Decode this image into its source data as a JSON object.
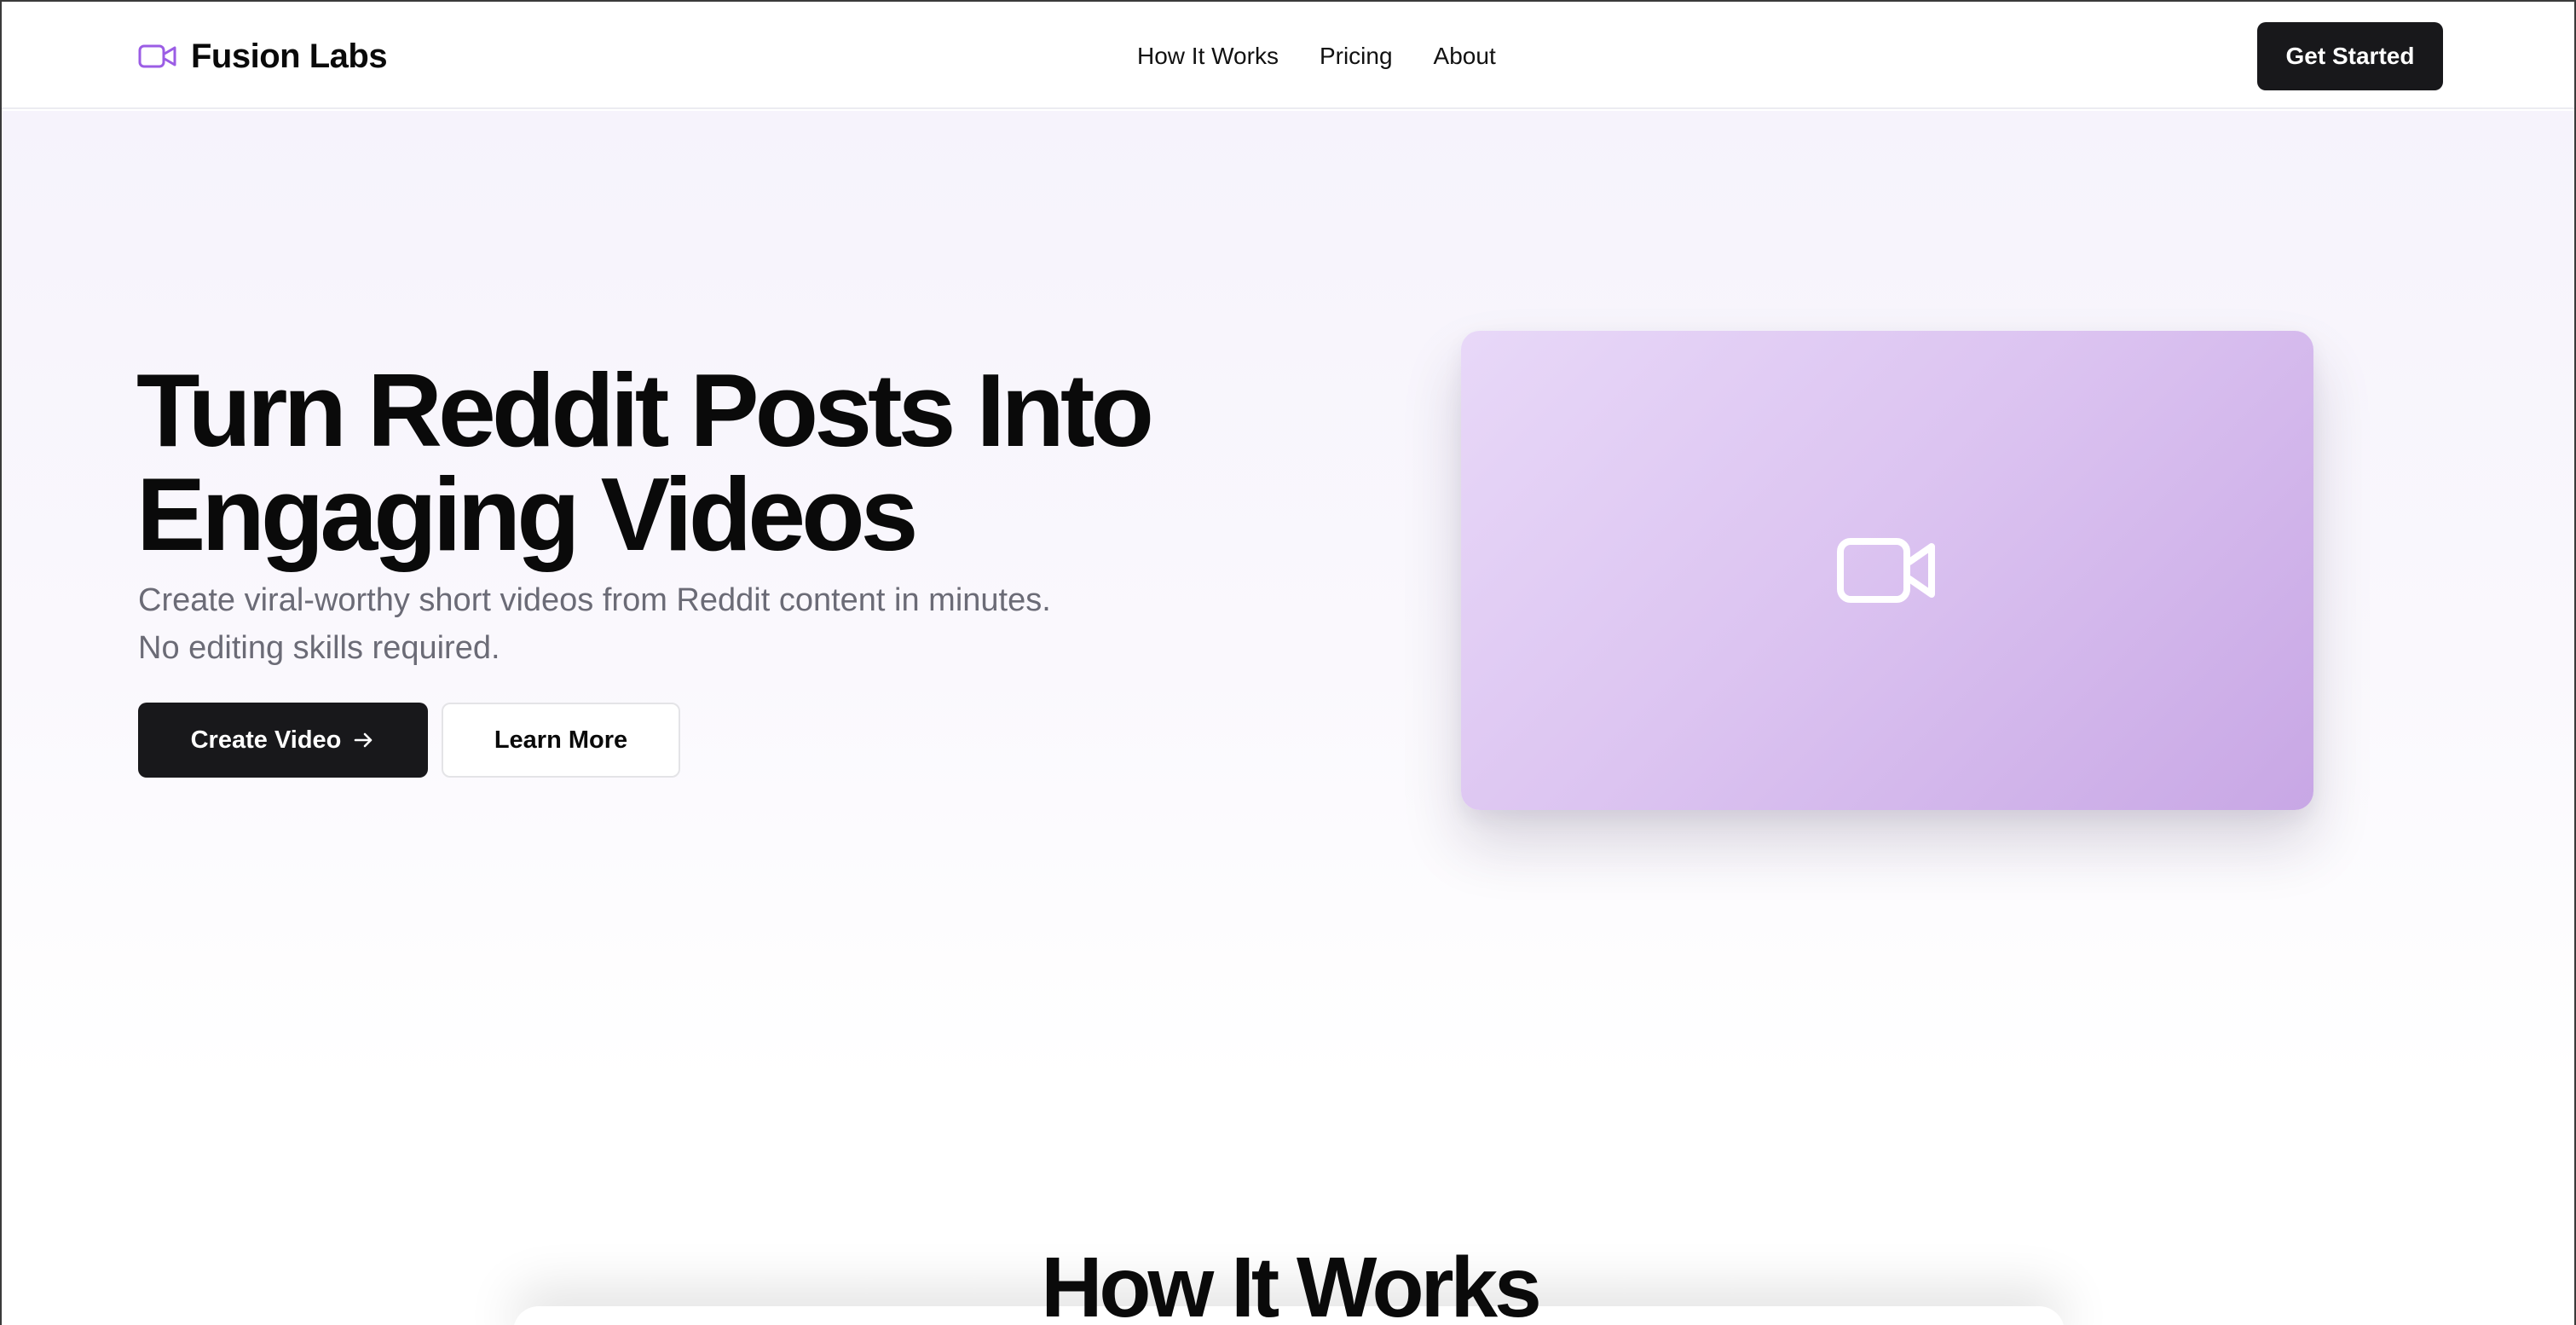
{
  "header": {
    "brand_name": "Fusion Labs",
    "brand_icon": "video-camera-icon",
    "nav": [
      {
        "label": "How It Works"
      },
      {
        "label": "Pricing"
      },
      {
        "label": "About"
      }
    ],
    "cta_label": "Get Started"
  },
  "hero": {
    "title_line1": "Turn Reddit Posts Into",
    "title_line2": "Engaging Videos",
    "subtitle_line1": "Create viral-worthy short videos from Reddit content in minutes.",
    "subtitle_line2": "No editing skills required.",
    "primary_button": "Create Video",
    "secondary_button": "Learn More",
    "preview_icon": "video-camera-icon"
  },
  "how_it_works": {
    "title": "How It Works"
  },
  "colors": {
    "accent": "#9b5de5",
    "dark": "#18181b",
    "card_gradient_start": "#e8d8f8",
    "card_gradient_end": "#c8a7e5",
    "muted_text": "#6b6b76"
  }
}
